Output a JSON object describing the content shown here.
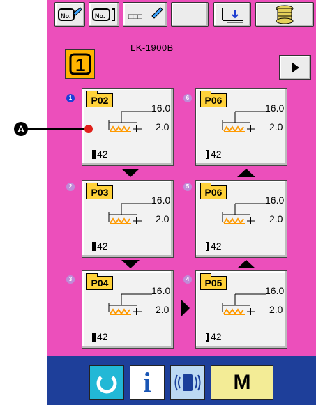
{
  "header": {
    "model": "LK-1900B",
    "toolbar_icons": [
      "pattern-no-edit-icon",
      "pattern-no-register-icon",
      "name-edit-icon",
      "blank-button",
      "thread-clamp-icon",
      "bobbin-winder-icon"
    ],
    "toolbar_icon_texts": [
      "No.",
      "No.",
      "□□□"
    ],
    "pattern_mode_icon": "pattern-mode-1-icon",
    "pattern_mode_label": "1",
    "next_page_icon": "play-right-icon"
  },
  "cards": [
    {
      "index": "1",
      "pattern": "P02",
      "length": "16.0",
      "width": "2.0",
      "count": "42",
      "selected": true
    },
    {
      "index": "2",
      "pattern": "P03",
      "length": "16.0",
      "width": "2.0",
      "count": "42",
      "selected": false
    },
    {
      "index": "3",
      "pattern": "P04",
      "length": "16.0",
      "width": "2.0",
      "count": "42",
      "selected": false
    },
    {
      "index": "6",
      "pattern": "P06",
      "length": "16.0",
      "width": "2.0",
      "count": "42",
      "selected": false
    },
    {
      "index": "5",
      "pattern": "P06",
      "length": "16.0",
      "width": "2.0",
      "count": "42",
      "selected": false
    },
    {
      "index": "4",
      "pattern": "P05",
      "length": "16.0",
      "width": "2.0",
      "count": "42",
      "selected": false
    }
  ],
  "callout": {
    "label": "A"
  },
  "bottom": {
    "reset_icon": "reset-circle-icon",
    "info_label": "i",
    "info_icon": "info-icon",
    "comm_icon": "communication-icon",
    "mode_label": "M",
    "mode_icon": "mode-icon"
  },
  "colors": {
    "panel": "#ec4fbb",
    "bottom_bar": "#1e3f9a",
    "pattern_tag": "#ffd23a",
    "stitch": "#ff9a00",
    "selected_dot": "#1a3fd8",
    "reset_button": "#22b8d6",
    "mode_button": "#f3ec96"
  }
}
